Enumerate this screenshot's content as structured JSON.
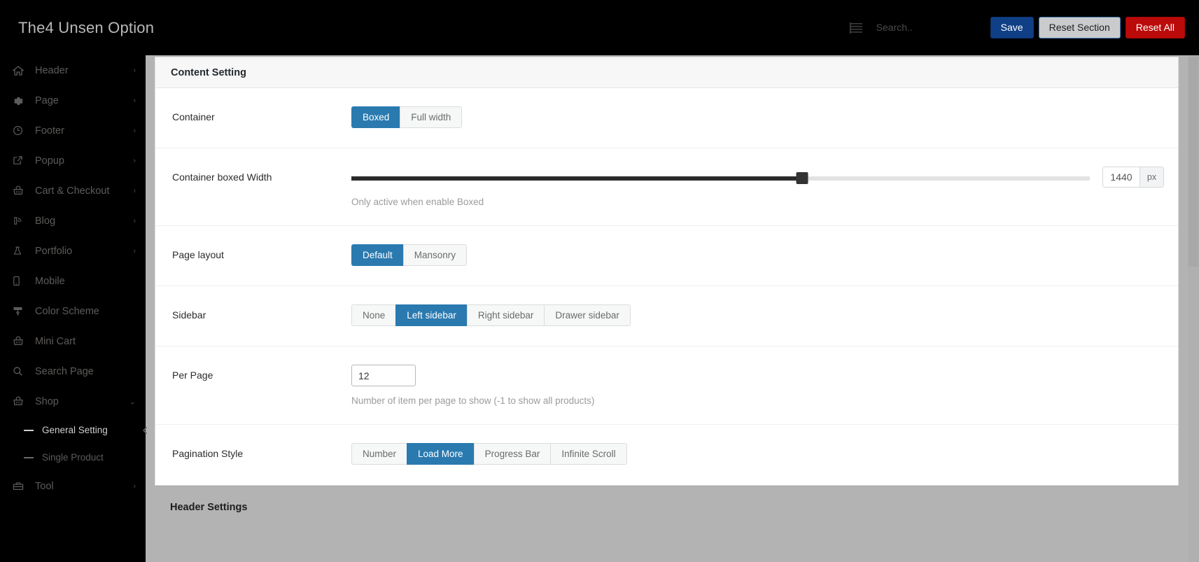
{
  "topbar": {
    "brand": "The4 Unsen Option",
    "expand_icon": "expand-list-icon",
    "search_placeholder": "Search..",
    "search_value": "",
    "save_label": "Save",
    "reset_section_label": "Reset Section",
    "reset_all_label": "Reset All",
    "colors": {
      "background": "#000000",
      "save": "#103f86",
      "reset_section": "#c9cbcd",
      "reset_all": "#bb0a0a"
    }
  },
  "sidebar": {
    "collapse_handle_icon": "chevron-left-icon",
    "items": [
      {
        "label": "Header",
        "icon": "home-icon",
        "chevron": "›",
        "active": false
      },
      {
        "label": "Page",
        "icon": "gear-icon",
        "chevron": "›",
        "active": false
      },
      {
        "label": "Footer",
        "icon": "clock-icon",
        "chevron": "›",
        "active": false
      },
      {
        "label": "Popup",
        "icon": "external-link-icon",
        "chevron": "›",
        "active": false
      },
      {
        "label": "Cart & Checkout",
        "icon": "basket-icon",
        "chevron": "›",
        "active": false
      },
      {
        "label": "Blog",
        "icon": "rss-icon",
        "chevron": "›",
        "active": false
      },
      {
        "label": "Portfolio",
        "icon": "flask-icon",
        "chevron": "›",
        "active": false
      },
      {
        "label": "Mobile",
        "icon": "mobile-icon",
        "chevron": "",
        "active": false
      },
      {
        "label": "Color Scheme",
        "icon": "paint-roller-icon",
        "chevron": "",
        "active": false
      },
      {
        "label": "Mini Cart",
        "icon": "basket-icon",
        "chevron": "",
        "active": false
      },
      {
        "label": "Search Page",
        "icon": "search-icon",
        "chevron": "",
        "active": false
      },
      {
        "label": "Shop",
        "icon": "basket-icon",
        "chevron": "⌄",
        "active": false
      }
    ],
    "sub_items": [
      {
        "label": "General Setting",
        "active": true
      },
      {
        "label": "Single Product",
        "active": false
      }
    ],
    "items_after": [
      {
        "label": "Tool",
        "icon": "toolbox-icon",
        "chevron": "›",
        "active": false
      }
    ]
  },
  "main": {
    "section_title": "Content Setting",
    "sub_section_title": "Header Settings",
    "rows": {
      "container": {
        "label": "Container",
        "options": [
          "Boxed",
          "Full width"
        ],
        "selected": "Boxed"
      },
      "container_width": {
        "label": "Container boxed Width",
        "value": "1440",
        "unit": "px",
        "help": "Only active when enable Boxed",
        "slider_percent": 61
      },
      "page_layout": {
        "label": "Page layout",
        "options": [
          "Default",
          "Mansonry"
        ],
        "selected": "Default"
      },
      "sidebar": {
        "label": "Sidebar",
        "options": [
          "None",
          "Left sidebar",
          "Right sidebar",
          "Drawer sidebar"
        ],
        "selected": "Left sidebar"
      },
      "per_page": {
        "label": "Per Page",
        "value": "12",
        "help": "Number of item per page to show (-1 to show all products)"
      },
      "pagination_style": {
        "label": "Pagination Style",
        "options": [
          "Number",
          "Load More",
          "Progress Bar",
          "Infinite Scroll"
        ],
        "selected": "Load More"
      }
    }
  }
}
